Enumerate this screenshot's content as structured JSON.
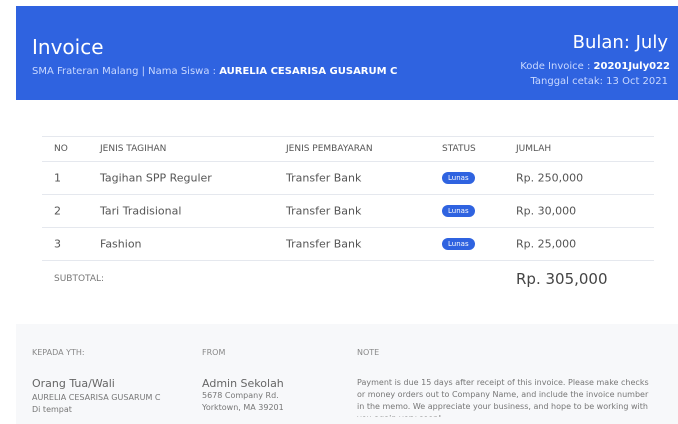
{
  "header": {
    "title": "Invoice",
    "school": "SMA Frateran Malang | Nama Siswa : ",
    "student": "AURELIA CESARISA GUSARUM C",
    "bulan": "Bulan: July",
    "kode_label": "Kode Invoice : ",
    "kode_value": "20201July022",
    "tanggal": "Tanggal cetak: 13 Oct 2021"
  },
  "table": {
    "headers": [
      "NO",
      "JENIS TAGIHAN",
      "JENIS PEMBAYARAN",
      "STATUS",
      "JUMLAH"
    ],
    "rows": [
      {
        "no": "1",
        "tagihan": "Tagihan SPP Reguler",
        "pembayaran": "Transfer Bank",
        "status": "Lunas",
        "jumlah": "Rp. 250,000"
      },
      {
        "no": "2",
        "tagihan": "Tari Tradisional",
        "pembayaran": "Transfer Bank",
        "status": "Lunas",
        "jumlah": "Rp. 30,000"
      },
      {
        "no": "3",
        "tagihan": "Fashion",
        "pembayaran": "Transfer Bank",
        "status": "Lunas",
        "jumlah": "Rp. 25,000"
      }
    ],
    "subtotal_label": "SUBTOTAL:",
    "subtotal_value": "Rp. 305,000"
  },
  "footer": {
    "kepada_label": "KEPADA YTH:",
    "kepada_name": "Orang Tua/Wali",
    "kepada_line1": "AURELIA CESARISA GUSARUM C",
    "kepada_line2": "Di tempat",
    "from_label": "FROM",
    "from_name": "Admin Sekolah",
    "from_line1": "5678 Company Rd.",
    "from_line2": "Yorktown, MA 39201",
    "note_label": "NOTE",
    "note_text": "Payment is due 15 days after receipt of this invoice. Please make checks or money orders out to Company Name, and include the invoice number in the memo. We appreciate your business, and hope to be working with you again very soon!"
  }
}
